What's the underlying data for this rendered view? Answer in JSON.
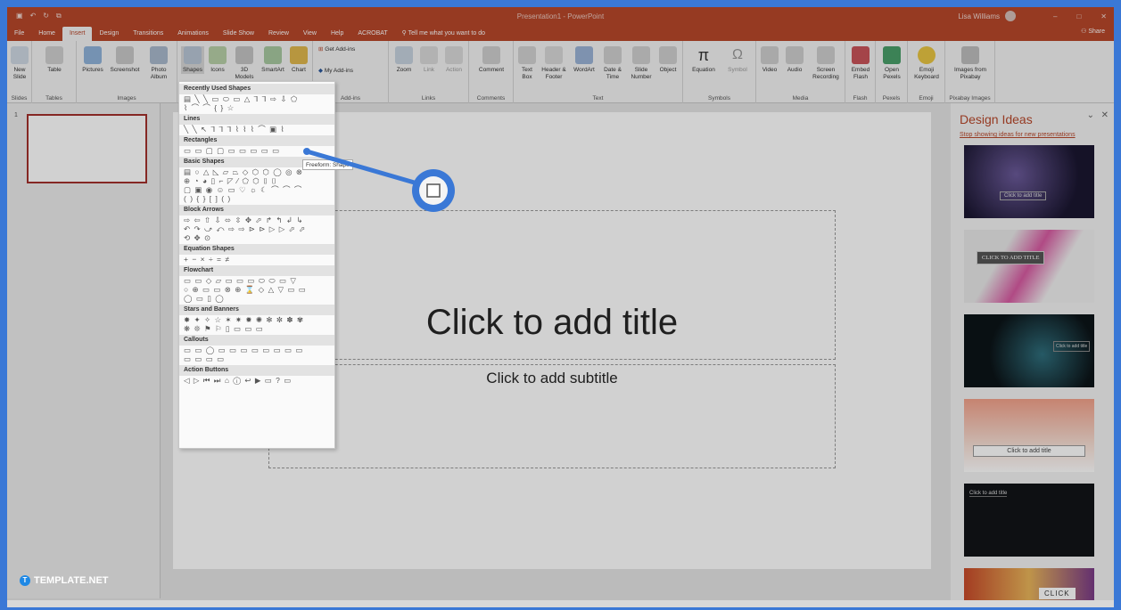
{
  "window": {
    "doc_title": "Presentation1 - PowerPoint",
    "user": "Lisa Williams"
  },
  "menu": {
    "tabs": [
      "File",
      "Home",
      "Insert",
      "Design",
      "Transitions",
      "Animations",
      "Slide Show",
      "Review",
      "View",
      "Help",
      "ACROBAT"
    ],
    "tell_me": "Tell me what you want to do",
    "share": "Share"
  },
  "ribbon": {
    "buttons": [
      "New Slide",
      "Table",
      "Pictures",
      "Screenshot",
      "Photo Album",
      "Shapes",
      "Icons",
      "3D Models",
      "SmartArt",
      "Chart",
      "Get Add-ins",
      "My Add-ins",
      "Zoom",
      "Link",
      "Action",
      "Comment",
      "Text Box",
      "Header & Footer",
      "WordArt",
      "Date & Time",
      "Slide Number",
      "Object",
      "Equation",
      "Symbol",
      "Video",
      "Audio",
      "Screen Recording",
      "Embed Flash",
      "Open Pexels",
      "Emoji Keyboard",
      "Images from Pixabay"
    ],
    "groups": [
      "Slides",
      "Tables",
      "Images",
      "Add-ins",
      "Links",
      "Comments",
      "Text",
      "Symbols",
      "Media",
      "Flash",
      "Pexels",
      "Emoji",
      "Pixabay Images"
    ]
  },
  "shapes_menu": {
    "sections": [
      {
        "name": "Recently Used Shapes",
        "rows": [
          "▤ ╲ ╲ ▭ ⬭ ▭ △ ⅂ ⅂ ⇨ ⇩ ⬠",
          "⌇ ⌒ ⌒ { } ☆"
        ]
      },
      {
        "name": "Lines",
        "rows": [
          "╲ ╲ ↖ ⅂ ⅂ ⅂ ⌇ ⌇ ⌇ ⌒ ▣ ⌇"
        ]
      },
      {
        "name": "Rectangles",
        "rows": [
          "▭ ▭ ▢ ▢ ▭ ▭ ▭ ▭ ▭"
        ]
      },
      {
        "name": "Basic Shapes",
        "rows": [
          "▤ ○ △ ◺ ▱ ⏢ ◇ ⬡ ⬡ ◯ ◎ ⊗",
          "⊕ ◔ ◕ ▯ ⌐ ◸ ⁄ ⬠ ⬡ ⌷ ⌷",
          "▢ ▣ ◉ ☺ ▭ ♡ ☼ ☾ ⌒ ⌒ ⌒",
          "( ) { } [ ] ( )"
        ]
      },
      {
        "name": "Block Arrows",
        "rows": [
          "⇨ ⇦ ⇧ ⇩ ⬄ ⇳ ✥ ⬀ ↱ ↰ ↲ ↳",
          "↶ ↷ ⤻ ⤺ ⇨ ⇨ ⊳ ⊳ ▷ ▷ ⬀ ⬀",
          "⟲ ✥ ⊙"
        ]
      },
      {
        "name": "Equation Shapes",
        "rows": [
          "+ − × ÷ = ≠"
        ]
      },
      {
        "name": "Flowchart",
        "rows": [
          "▭ ▭ ◇ ▱ ▭ ▭ ▭ ⬭ ⬭ ▭ ▽",
          "○ ⊕ ▭ ▭ ⊗ ⊕ ⌛ ◇ △ ▽ ▭ ▭",
          "◯ ▭ ▯ ◯"
        ]
      },
      {
        "name": "Stars and Banners",
        "rows": [
          "✸ ✦ ✧ ☆ ✶ ✷ ✹ ✺ ✻ ✼ ✽ ✾",
          "❋ ❊ ⚑ ⚐ ▯ ▭ ▭ ▭"
        ]
      },
      {
        "name": "Callouts",
        "rows": [
          "▭ ▭ ◯ ▭ ▭ ▭ ▭ ▭ ▭ ▭ ▭",
          "▭ ▭ ▭ ▭"
        ]
      },
      {
        "name": "Action Buttons",
        "rows": [
          "◁ ▷ ⏮ ⏭ ⌂ ⓘ ↩ ▶ ▭ ? ▭"
        ]
      }
    ],
    "tooltip": "Freeform: Shape"
  },
  "slide": {
    "title_placeholder": "Click to add title",
    "subtitle_placeholder": "Click to add subtitle",
    "thumb_number": "1"
  },
  "design_ideas": {
    "title": "Design Ideas",
    "stop_link": "Stop showing ideas for new presentations",
    "ideas": [
      "Click to add title",
      "CLICK TO ADD TITLE",
      "Click to add title",
      "Click to add title",
      "Click to add title",
      "CLICK"
    ]
  },
  "brand": {
    "name": "TEMPLATE.NET"
  },
  "colors": {
    "accent": "#b7472a",
    "highlight": "#3a78d6"
  }
}
